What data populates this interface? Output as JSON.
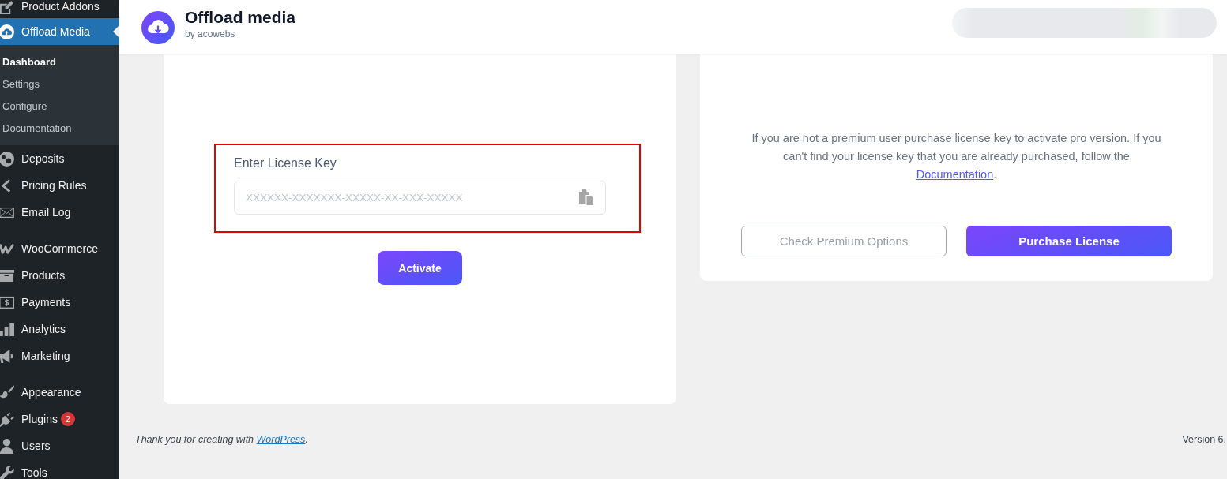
{
  "sidebar": {
    "sections": [
      [
        {
          "label": "Product Addons",
          "selected": false
        },
        {
          "label": "Offload Media",
          "selected": true,
          "submenu": [
            {
              "label": "Dashboard",
              "selected": true
            },
            {
              "label": "Settings",
              "selected": false
            },
            {
              "label": "Configure",
              "selected": false
            },
            {
              "label": "Documentation",
              "selected": false
            }
          ]
        },
        {
          "label": "Deposits",
          "selected": false
        },
        {
          "label": "Pricing Rules",
          "selected": false
        },
        {
          "label": "Email Log",
          "selected": false
        }
      ],
      [
        {
          "label": "WooCommerce",
          "selected": false
        },
        {
          "label": "Products",
          "selected": false
        },
        {
          "label": "Payments",
          "selected": false
        },
        {
          "label": "Analytics",
          "selected": false
        },
        {
          "label": "Marketing",
          "selected": false
        }
      ],
      [
        {
          "label": "Appearance",
          "selected": false
        },
        {
          "label": "Plugins",
          "selected": false,
          "badge": "2"
        },
        {
          "label": "Users",
          "selected": false
        },
        {
          "label": "Tools",
          "selected": false
        }
      ]
    ]
  },
  "header": {
    "title": "Offload media",
    "subtitle": "by acowebs"
  },
  "license_card": {
    "field": {
      "label": "Enter License Key",
      "placeholder": "XXXXXX-XXXXXXX-XXXXX-XX-XXX-XXXXX",
      "highlighted": true
    },
    "button": "Activate"
  },
  "premium_card": {
    "notice": {
      "text": "If you are not a premium user purchase license key to activate pro version. If you can't find your license key that you are already purchased, follow the",
      "link": "Documentation",
      "after": "."
    },
    "buttons": [
      {
        "label": "Check Premium Options",
        "kind": "outline"
      },
      {
        "label": "Purchase License",
        "kind": "primary"
      }
    ]
  },
  "footer": {
    "text": "Thank you for creating with",
    "link": "WordPress",
    "after": ".",
    "version": "Version 6."
  }
}
